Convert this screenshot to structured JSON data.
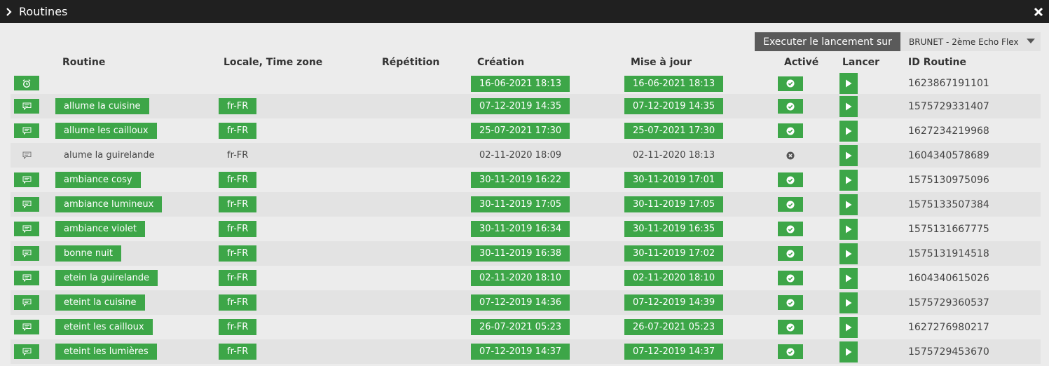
{
  "window": {
    "title": "Routines",
    "close_icon": "close-icon",
    "expand_icon": "chevron-right-icon"
  },
  "toolbar": {
    "execute_label": "Executer le lancement sur",
    "device_selected": "BRUNET - 2ème Echo Flex"
  },
  "columns": {
    "routine": "Routine",
    "locale": "Locale, Time zone",
    "repeat": "Répétition",
    "created": "Création",
    "updated": "Mise à jour",
    "enabled": "Activé",
    "launch": "Lancer",
    "id": "ID Routine"
  },
  "colors": {
    "green": "#3da648",
    "titlebar": "#202020",
    "exec_button": "#5a5a5a"
  },
  "rows": [
    {
      "type": "alarm",
      "name": "",
      "locale": "",
      "repeat": "",
      "created": "16-06-2021 18:13",
      "updated": "16-06-2021 18:13",
      "enabled": true,
      "id": "1623867191101"
    },
    {
      "type": "voice",
      "name": "allume la cuisine",
      "locale": "fr-FR",
      "repeat": "",
      "created": "07-12-2019 14:35",
      "updated": "07-12-2019 14:35",
      "enabled": true,
      "id": "1575729331407"
    },
    {
      "type": "voice",
      "name": "allume les cailloux",
      "locale": "fr-FR",
      "repeat": "",
      "created": "25-07-2021 17:30",
      "updated": "25-07-2021 17:30",
      "enabled": true,
      "id": "1627234219968"
    },
    {
      "type": "voice",
      "name": "alume la guirelande",
      "locale": "fr-FR",
      "repeat": "",
      "created": "02-11-2020 18:09",
      "updated": "02-11-2020 18:13",
      "enabled": false,
      "id": "1604340578689"
    },
    {
      "type": "voice",
      "name": "ambiance cosy",
      "locale": "fr-FR",
      "repeat": "",
      "created": "30-11-2019 16:22",
      "updated": "30-11-2019 17:01",
      "enabled": true,
      "id": "1575130975096"
    },
    {
      "type": "voice",
      "name": "ambiance lumineux",
      "locale": "fr-FR",
      "repeat": "",
      "created": "30-11-2019 17:05",
      "updated": "30-11-2019 17:05",
      "enabled": true,
      "id": "1575133507384"
    },
    {
      "type": "voice",
      "name": "ambiance violet",
      "locale": "fr-FR",
      "repeat": "",
      "created": "30-11-2019 16:34",
      "updated": "30-11-2019 16:35",
      "enabled": true,
      "id": "1575131667775"
    },
    {
      "type": "voice",
      "name": "bonne nuit",
      "locale": "fr-FR",
      "repeat": "",
      "created": "30-11-2019 16:38",
      "updated": "30-11-2019 17:02",
      "enabled": true,
      "id": "1575131914518"
    },
    {
      "type": "voice",
      "name": "etein la guirelande",
      "locale": "fr-FR",
      "repeat": "",
      "created": "02-11-2020 18:10",
      "updated": "02-11-2020 18:10",
      "enabled": true,
      "id": "1604340615026"
    },
    {
      "type": "voice",
      "name": "eteint la cuisine",
      "locale": "fr-FR",
      "repeat": "",
      "created": "07-12-2019 14:36",
      "updated": "07-12-2019 14:39",
      "enabled": true,
      "id": "1575729360537"
    },
    {
      "type": "voice",
      "name": "eteint les cailloux",
      "locale": "fr-FR",
      "repeat": "",
      "created": "26-07-2021 05:23",
      "updated": "26-07-2021 05:23",
      "enabled": true,
      "id": "1627276980217"
    },
    {
      "type": "voice",
      "name": "eteint les lumières",
      "locale": "fr-FR",
      "repeat": "",
      "created": "07-12-2019 14:37",
      "updated": "07-12-2019 14:37",
      "enabled": true,
      "id": "1575729453670"
    }
  ]
}
